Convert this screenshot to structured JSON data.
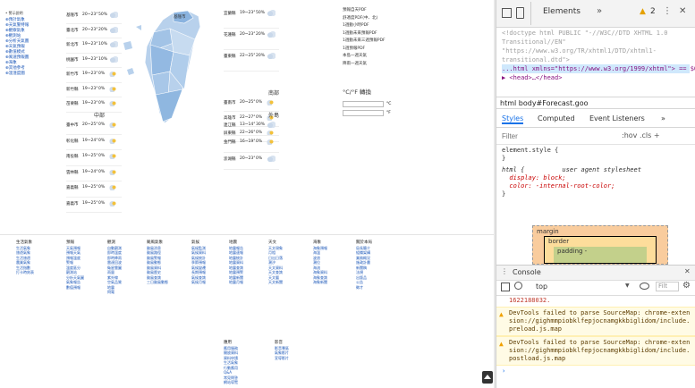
{
  "left_nav": {
    "header": "• 警示說明",
    "items": [
      "⊕預計氣象",
      "⊕天氣警特報",
      "⊕觀察氣象",
      "⊕觀測站",
      "⊕分析天氣圖",
      "⊕天氣預報",
      "⊕數值模式",
      "⊕風速預報圖",
      "⊕海象",
      "⊕其他參考",
      "⊕溫溼度圖"
    ]
  },
  "north": {
    "rows": [
      {
        "city": "基隆市",
        "temp": "20~23°",
        "rain": "50%",
        "icon": "cloud"
      },
      {
        "city": "臺北市",
        "temp": "20~23°",
        "rain": "20%",
        "icon": "cloud"
      },
      {
        "city": "新北市",
        "temp": "19~23°",
        "rain": "10%",
        "icon": "cloud"
      },
      {
        "city": "桃園市",
        "temp": "19~23°",
        "rain": "10%",
        "icon": "cloud"
      },
      {
        "city": "新竹市",
        "temp": "19~23°",
        "rain": "0%",
        "icon": "sunrain"
      },
      {
        "city": "新竹縣",
        "temp": "19~23°",
        "rain": "0%",
        "icon": "sunrain"
      },
      {
        "city": "苗栗縣",
        "temp": "19~23°",
        "rain": "0%",
        "icon": "sunrain"
      }
    ]
  },
  "central": {
    "title": "中部",
    "rows": [
      {
        "city": "臺中市",
        "temp": "20~25°",
        "rain": "0%",
        "icon": "sunrain"
      },
      {
        "city": "彰化縣",
        "temp": "19~24°",
        "rain": "0%",
        "icon": "sunrain"
      },
      {
        "city": "南投縣",
        "temp": "19~25°",
        "rain": "0%",
        "icon": "sunrain"
      },
      {
        "city": "雲林縣",
        "temp": "19~24°",
        "rain": "0%",
        "icon": "sunrain"
      },
      {
        "city": "嘉義縣",
        "temp": "19~25°",
        "rain": "0%",
        "icon": "sunrain"
      },
      {
        "city": "嘉義市",
        "temp": "19~25°",
        "rain": "0%",
        "icon": "sunrain"
      }
    ]
  },
  "east": {
    "rows": [
      {
        "city": "宜蘭縣",
        "temp": "19~23°",
        "rain": "50%",
        "icon": "cloud"
      },
      {
        "city": "花蓮縣",
        "temp": "20~23°",
        "rain": "20%",
        "icon": "cloud"
      },
      {
        "city": "臺東縣",
        "temp": "22~25°",
        "rain": "20%",
        "icon": "cloud"
      }
    ]
  },
  "south": {
    "title": "南部",
    "rows": [
      {
        "city": "臺南市",
        "temp": "20~25°",
        "rain": "0%",
        "icon": "sunrain"
      },
      {
        "city": "高雄市",
        "temp": "22~27°",
        "rain": "0%",
        "icon": "sunrain"
      },
      {
        "city": "屏東縣",
        "temp": "22~26°",
        "rain": "0%",
        "icon": "sunrain"
      }
    ]
  },
  "islands": {
    "title": "外島",
    "rows": [
      {
        "city": "連江縣",
        "temp": "13~14°",
        "rain": "30%",
        "icon": "cloud"
      },
      {
        "city": "金門縣",
        "temp": "16~19°",
        "rain": "0%",
        "icon": "sunrain"
      },
      {
        "city": "澎湖縣",
        "temp": "20~23°",
        "rain": "0%",
        "icon": "cloud"
      }
    ]
  },
  "map": {
    "north_label": "基隆市"
  },
  "link_panel": {
    "lines": [
      "預報自天PDF",
      "舒適度PDF(中、北)",
      "1週動小時PDF",
      "1週動未來預報PDF",
      "1週動未來三週預報PDF",
      "1週預報PDF",
      "本島一週天氣",
      "降雨一週天氣"
    ],
    "unit_title": "°C/°F 轉換",
    "unit_c": "°C",
    "unit_f": "°F"
  },
  "footer": {
    "cols": [
      {
        "title": "生活氣象",
        "items": [
          "生活氣象",
          "旅遊氣象",
          "生活旅遊",
          "農業氣象",
          "生活指數",
          "打卡時刻表"
        ]
      },
      {
        "title": "預報",
        "items": [
          "天氣預報",
          "預報天氣",
          "預報溫度",
          "警報",
          "溫度區分",
          "觀測站",
          "分析天氣圖",
          "氣象報告",
          "數值預報"
        ]
      },
      {
        "title": "觀測",
        "items": [
          "自動觀測",
          "即時溫度",
          "即時降雨",
          "雷達回波",
          "衛星雲圖",
          "雨量",
          "紫外線",
          "空氣品質",
          "地震",
          "閃電"
        ]
      },
      {
        "title": "颱風氣象",
        "items": [
          "颱風消息",
          "颱風路徑",
          "颱風警報",
          "颱風動態",
          "颱風資料",
          "颱風歷史",
          "颱風查詢",
          "三日颱風動態"
        ]
      },
      {
        "title": "氣候",
        "items": [
          "氣候監測",
          "氣候資料",
          "氣候統計",
          "季節預報",
          "氣候變遷",
          "長期預報",
          "氣候查詢",
          "氣候月報"
        ]
      },
      {
        "title": "地震",
        "items": [
          "地震報告",
          "地震速報",
          "地震統計",
          "地震資料",
          "地震查詢",
          "地震預警",
          "地震新聞",
          "地震月報"
        ]
      },
      {
        "title": "天文",
        "items": [
          "天文現象",
          "月相",
          "日出日落",
          "潮汐",
          "天文資料",
          "天文查詢",
          "天文曆",
          "天文新聞"
        ]
      },
      {
        "title": "海象",
        "items": [
          "海象預報",
          "海溫",
          "波浪",
          "潮位",
          "海流",
          "海象資料",
          "海象查詢",
          "海象新聞"
        ]
      },
      {
        "title": "關於本局",
        "items": [
          "局長簡介",
          "組織架構",
          "業務概況",
          "施政計畫",
          "新聞稿",
          "法規",
          "出版品",
          "公告",
          "徵才"
        ]
      }
    ],
    "extra_col": {
      "title": "應用",
      "items": [
        "應用服務",
        "開放資料",
        "資料申請",
        "生活氣象",
        "行動應用",
        "Q&A",
        "常見問答",
        "網站導覽"
      ]
    },
    "extra_col2": {
      "title": "影音",
      "items": [
        "影音專區",
        "氣象影片",
        "宣導影片"
      ]
    }
  },
  "devtools": {
    "tab_title": "Elements",
    "warn_count": "2",
    "code_lines": [
      "<!doctype html PUBLIC \"-//W3C//DTD XHTML 1.0",
      "Transitional//EN\"",
      "\"https://www.w3.org/TR/xhtml1/DTD/xhtml1-",
      "transitional.dtd\">",
      "...html xmlns=\"https://www.w3.org/1999/xhtml\"> == $0",
      "▶ <head>…</head>"
    ],
    "breadcrumb": "html   body#Forecast.goo",
    "style_tabs": [
      "Styles",
      "Computed",
      "Event Listeners",
      "»"
    ],
    "filter_placeholder": "Filter",
    "filter_right": ":hov  .cls  +",
    "style_lines": [
      "element.style {",
      "}",
      "html {          user agent stylesheet",
      "  display: block;",
      "  color: -internal-root-color;",
      "}"
    ],
    "boxmodel": {
      "margin": "margin",
      "border": "border",
      "padding": "padding -"
    },
    "console_title": "Console",
    "console_context": "top",
    "console_filter": "Filt",
    "console_lines": [
      {
        "type": "plain",
        "text": "1622188032."
      },
      {
        "type": "warn",
        "text": "DevTools failed to parse SourceMap: chrome-extension://gighmmpiobklfepjocnamgkkbiglidom/include.preload.js.map"
      },
      {
        "type": "warn",
        "text": "DevTools failed to parse SourceMap: chrome-extension://gighmmpiobklfepjocnamgkkbiglidom/include.postload.js.map"
      }
    ]
  },
  "colors": {
    "link": "#1a56b8",
    "warn_bg": "#fffbe5",
    "accent": "#f0a100"
  }
}
